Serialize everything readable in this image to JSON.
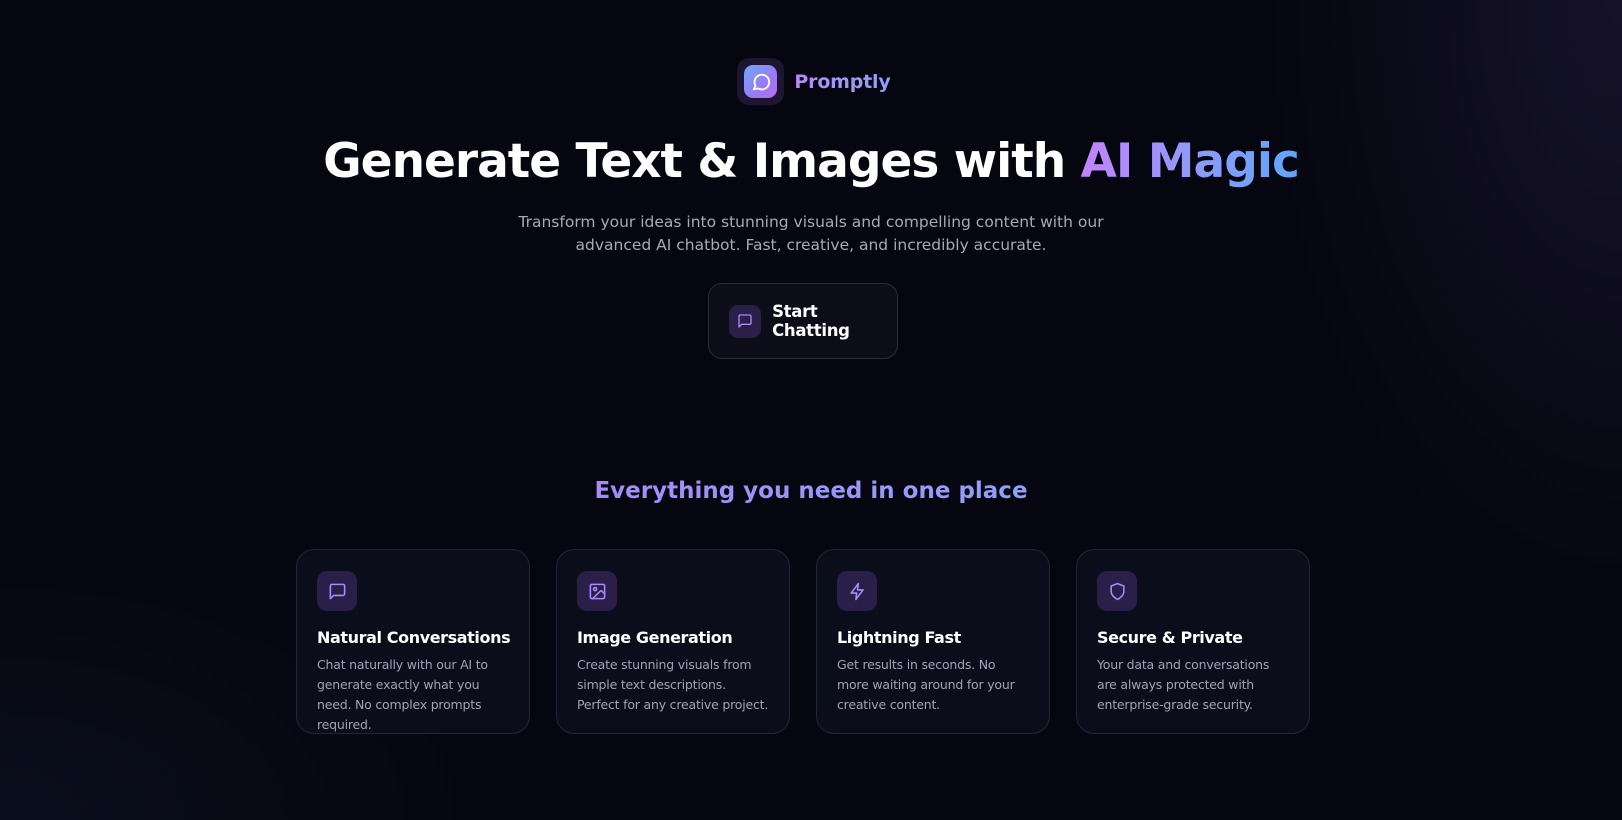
{
  "brand": {
    "name": "Promptly",
    "logo_icon": "chat-bubble-icon"
  },
  "hero": {
    "title_main": "Generate Text & Images with ",
    "title_accent": "AI Magic",
    "subtitle": "Transform your ideas into stunning visuals and compelling content with our advanced AI chatbot. Fast, creative, and incredibly accurate."
  },
  "cta": {
    "label": "Start Chatting",
    "icon": "message-square-icon"
  },
  "features": {
    "heading": "Everything you need in one place",
    "items": [
      {
        "title": "Natural Conversations",
        "description": "Chat naturally with our AI to generate exactly what you need. No complex prompts required.",
        "icon": "message-square-icon"
      },
      {
        "title": "Image Generation",
        "description": "Create stunning visuals from simple text descriptions. Perfect for any creative project.",
        "icon": "image-icon"
      },
      {
        "title": "Lightning Fast",
        "description": "Get results in seconds. No more waiting around for your creative content.",
        "icon": "lightning-bolt-icon"
      },
      {
        "title": "Secure & Private",
        "description": "Your data and conversations are always protected with enterprise-grade security.",
        "icon": "shield-icon"
      }
    ]
  },
  "colors": {
    "background": "#05060f",
    "accent_purple": "#c084fc",
    "accent_blue": "#60a5fa",
    "icon_tile": "#2a1f48",
    "icon_stroke": "#a78bfa"
  }
}
